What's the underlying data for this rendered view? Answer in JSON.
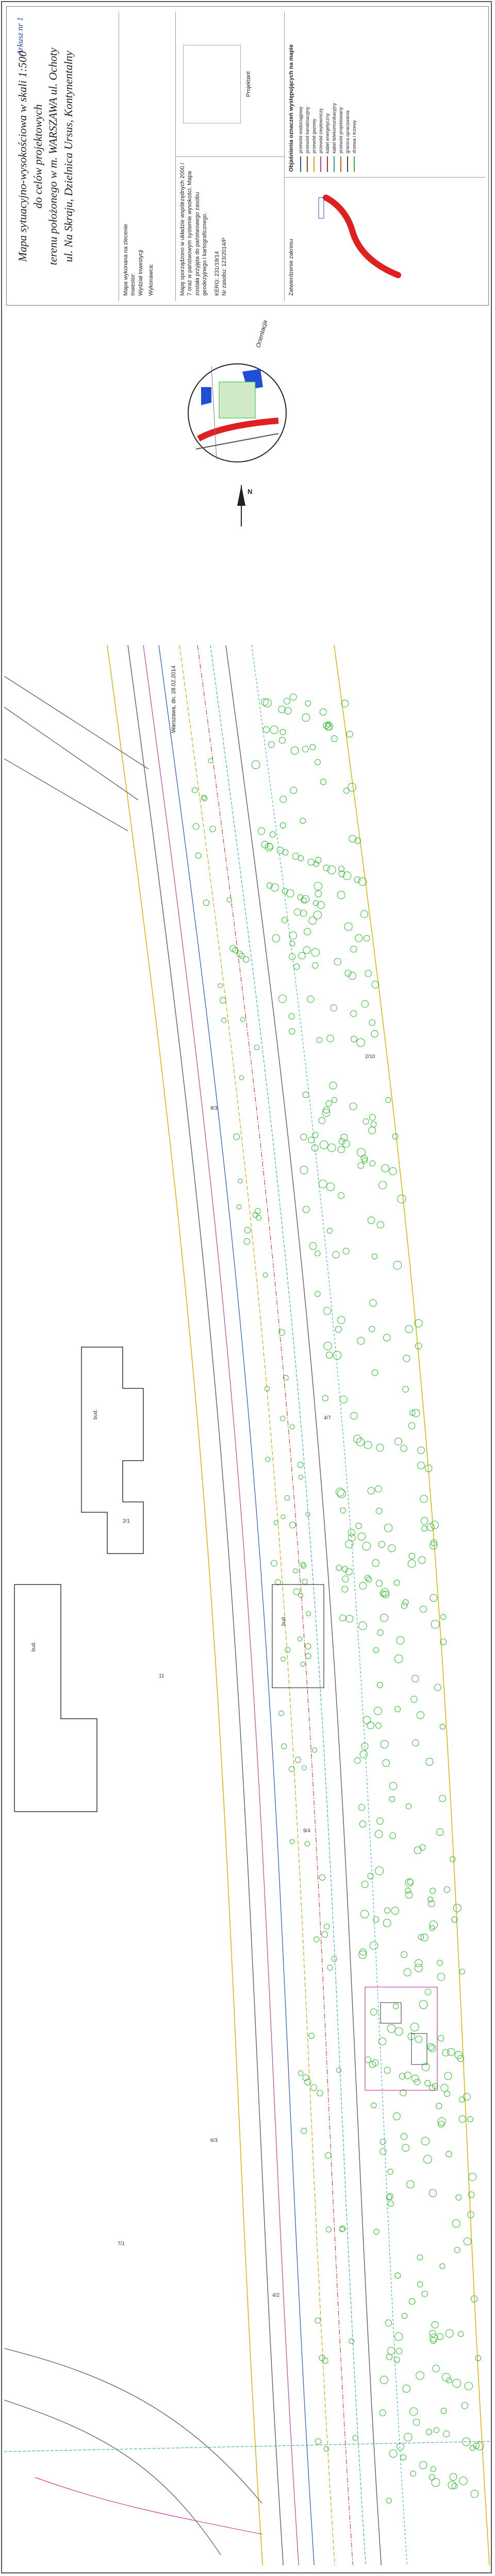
{
  "title_block": {
    "title_lines": [
      "Mapa sytuacyjno-wysokościowa w skali 1:500",
      "do celów projektowych",
      "terenu położonego w m. WARSZAWA ul. Ochoty",
      "ul. Na Skraju, Dzielnica Ursus, Kontynentalny"
    ],
    "sheet_label": "Arkusz nr 1",
    "client_lines": [
      "Mapa wykonana na zlecenie",
      "Inwestor:",
      "Wydział Inwestycji"
    ],
    "executor_label": "Wykonawca:",
    "cert_text": "Mapę sporządzono w układzie współrzędnych 2000 / 7 oraz w państwowym systemie wysokości. Mapa została przyjęta do państwowego zasobu geodezyjnego i kartograficznego.",
    "id_text": "KERG: 231/19/14",
    "registry_text": "Nr zasobu: 123/2014/P",
    "approval_label": "Zatwierdzenie zakresu",
    "signature_label": "Projektant",
    "legend_title": "Objaśnienia oznaczeń występujących na mapie",
    "legend_items": [
      {
        "label": "przewód wodociągowy",
        "color": "#1f4fd6"
      },
      {
        "label": "przewód kanalizacyjny",
        "color": "#8b4513"
      },
      {
        "label": "przewód gazowy",
        "color": "#e0a000"
      },
      {
        "label": "przewód ciepłowniczy",
        "color": "#d6369b"
      },
      {
        "label": "kabel energetyczny",
        "color": "#d02020"
      },
      {
        "label": "kabel telekomunikacyjny",
        "color": "#1aa7a7"
      },
      {
        "label": "przewód projektowany",
        "color": "#e05a00"
      },
      {
        "label": "granica opracowania",
        "color": "#444444"
      },
      {
        "label": "drzewa i krzewy",
        "color": "#2dbb2d"
      }
    ],
    "orientation_label": "Orientacja",
    "north_label": "N",
    "date_text": "Warszawa, dn. 28.02.2014"
  },
  "map": {
    "parcel_labels": [
      "2/1",
      "8/3",
      "4/7",
      "11",
      "9/4",
      "6/3",
      "2/10",
      "4/2",
      "7/1"
    ],
    "building_labels": [
      "bud.",
      "bud.",
      "bud."
    ],
    "street_labels": [
      "ul. Ochoty",
      "ul. Na Skraju"
    ],
    "colors": {
      "water": "#1f4fd6",
      "gas": "#e0a000",
      "heat": "#d6369b",
      "power": "#d02020",
      "telecom": "#1aa7a7",
      "vegetation": "#2dbb2d",
      "road": "#666666",
      "road_yellow": "#e0b000"
    }
  }
}
